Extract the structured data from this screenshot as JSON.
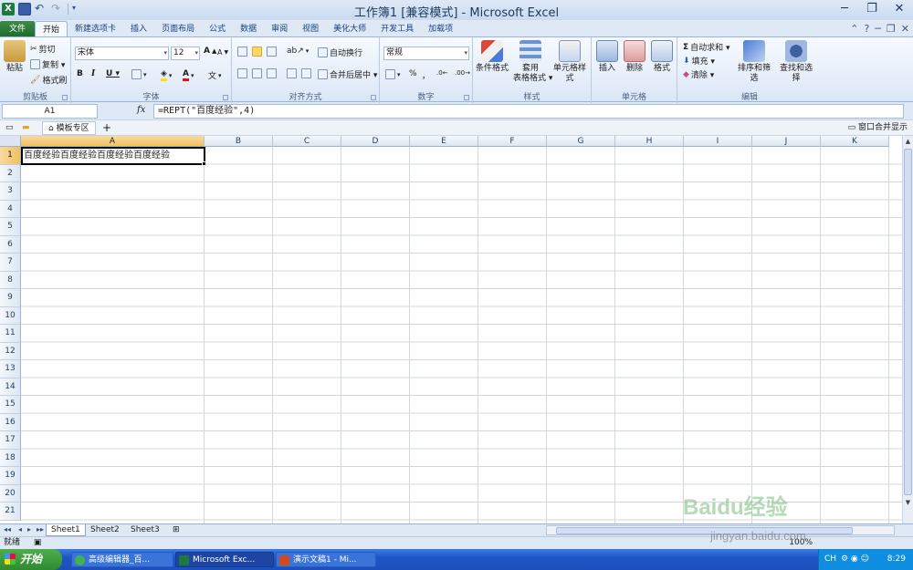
{
  "titlebar": {
    "title": "工作簿1  [兼容模式]  -  Microsoft Excel",
    "minimize": "─",
    "restore": "❐",
    "close": "✕"
  },
  "ribbon_tabs": [
    {
      "label": "文件"
    },
    {
      "label": "开始"
    },
    {
      "label": "新建选项卡"
    },
    {
      "label": "插入"
    },
    {
      "label": "页面布局"
    },
    {
      "label": "公式"
    },
    {
      "label": "数据"
    },
    {
      "label": "审阅"
    },
    {
      "label": "视图"
    },
    {
      "label": "美化大师"
    },
    {
      "label": "开发工具"
    },
    {
      "label": "加载项"
    }
  ],
  "ribbon": {
    "clipboard": {
      "paste": "粘贴",
      "cut": "剪切",
      "copy": "复制 ▾",
      "format_painter": "格式刷",
      "label": "剪贴板"
    },
    "font": {
      "name": "宋体",
      "size": "12",
      "bold": "B",
      "italic": "I",
      "underline": "U ▾",
      "label": "字体",
      "grow": "A",
      "shrink": "A"
    },
    "alignment": {
      "wrap": "自动换行",
      "merge": "合并后居中 ▾",
      "label": "对齐方式"
    },
    "number": {
      "format": "常规",
      "percent": "%",
      "comma": "，",
      "label": "数字"
    },
    "styles": {
      "conditional": "条件格式",
      "table": "套用\n表格格式 ▾",
      "cell": "单元格样式",
      "label": "样式"
    },
    "cells": {
      "insert": "插入",
      "delete": "删除",
      "format": "格式",
      "label": "单元格"
    },
    "editing": {
      "autosum": "自动求和 ▾",
      "fill": "填充 ▾",
      "clear": "清除 ▾",
      "sort": "排序和筛选",
      "find": "查找和选择",
      "label": "编辑"
    }
  },
  "formula_bar": {
    "name_box": "A1",
    "fx": "fx",
    "formula": "=REPT(\"百度经验\",4)"
  },
  "workbook_strip": {
    "template_zone": "模板专区",
    "add": "+",
    "window_merge": "窗口合并显示"
  },
  "grid": {
    "columns": [
      "A",
      "B",
      "C",
      "D",
      "E",
      "F",
      "G",
      "H",
      "I",
      "J",
      "K"
    ],
    "rows": [
      "1",
      "2",
      "3",
      "4",
      "5",
      "6",
      "7",
      "8",
      "9",
      "10",
      "11",
      "12",
      "13",
      "14",
      "15",
      "16",
      "17",
      "18",
      "19",
      "20",
      "21"
    ],
    "selected_cell": "A1",
    "a1_value": "百度经验百度经验百度经验百度经验"
  },
  "sheets": [
    {
      "label": "Sheet1",
      "active": true
    },
    {
      "label": "Sheet2",
      "active": false
    },
    {
      "label": "Sheet3",
      "active": false
    }
  ],
  "statusbar": {
    "ready": "就绪",
    "zoom": "100%"
  },
  "taskbar": {
    "start": "开始",
    "tasks": [
      {
        "label": "高级编辑器_百...",
        "active": false
      },
      {
        "label": "Microsoft Exc...",
        "active": true
      },
      {
        "label": "演示文稿1 - Mi...",
        "active": false
      }
    ],
    "lang": "CH",
    "clock": "8:29"
  },
  "watermark": {
    "brand": "Baidu经验",
    "url": "jingyan.baidu.com"
  },
  "colors": {
    "accent": "#1e7a3c",
    "selected_header": "#f1c15f",
    "taskbar": "#1f55c5"
  }
}
